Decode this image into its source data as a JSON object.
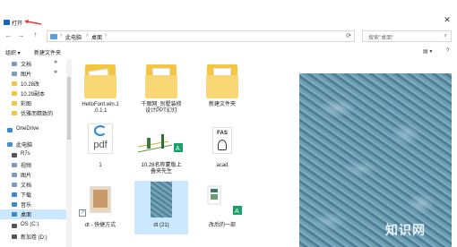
{
  "window": {
    "title": "打开",
    "close_glyph": "✕"
  },
  "nav": {
    "back": "←",
    "forward": "→",
    "up": "↑",
    "breadcrumbs": [
      "此电脑",
      "桌面"
    ],
    "refresh_glyph": "⟳",
    "search_placeholder": "搜索\"桌面\"",
    "search_glyph": "⌕"
  },
  "toolbar": {
    "organize": "组织 ▾",
    "new_folder": "新建文件夹",
    "view_glyph": "▤ ▾",
    "help_glyph": "?"
  },
  "sidebar": {
    "items": [
      {
        "label": "文档",
        "icon": "document-icon",
        "color": "#7a9cc6",
        "pin": "✱"
      },
      {
        "label": "图片",
        "icon": "picture-icon",
        "color": "#7a9cc6",
        "pin": "✱"
      },
      {
        "label": "10.28改",
        "icon": "folder-icon",
        "color": "#f5c542"
      },
      {
        "label": "10.29副本",
        "icon": "folder-icon",
        "color": "#f5c542"
      },
      {
        "label": "彩图",
        "icon": "folder-icon",
        "color": "#f5c542"
      },
      {
        "label": "优雅而精致的",
        "icon": "folder-icon",
        "color": "#f5c542"
      },
      {
        "label": "OneDrive",
        "icon": "cloud-icon",
        "color": "#3a88d8"
      },
      {
        "label": "此电脑",
        "icon": "pc-icon",
        "color": "#4a8fd1"
      },
      {
        "label": "R7s",
        "icon": "device-icon",
        "color": "#555555"
      },
      {
        "label": "视频",
        "icon": "video-icon",
        "color": "#7a9cc6"
      },
      {
        "label": "图片",
        "icon": "picture-icon",
        "color": "#7a9cc6"
      },
      {
        "label": "文档",
        "icon": "document-icon",
        "color": "#7a9cc6"
      },
      {
        "label": "下载",
        "icon": "download-icon",
        "color": "#3a88d8"
      },
      {
        "label": "音乐",
        "icon": "music-icon",
        "color": "#3a88d8"
      },
      {
        "label": "桌面",
        "icon": "desktop-icon",
        "color": "#3a88d8"
      },
      {
        "label": "OS (C:)",
        "icon": "drive-icon",
        "color": "#555555"
      },
      {
        "label": "新加卷 (D:)",
        "icon": "drive-icon",
        "color": "#555555"
      }
    ],
    "selected_index": 14
  },
  "files": [
    {
      "name": "HelloFont.win.1\n.0.1.1",
      "kind": "folder"
    },
    {
      "name": "千图网_别墅装修\n设计PPT幻灯",
      "kind": "folder"
    },
    {
      "name": "新建文件夹",
      "kind": "folder"
    },
    {
      "name": "1",
      "kind": "pdf",
      "badge": "pdf"
    },
    {
      "name": "10.28名称蒙版上\n叠来先生",
      "kind": "image"
    },
    {
      "name": "acad",
      "kind": "fas",
      "badge": "FAS"
    },
    {
      "name": "dt - 快捷方式",
      "kind": "shortcut"
    },
    {
      "name": "dt (21)",
      "kind": "image-selected"
    },
    {
      "name": "改后的一部",
      "kind": "image"
    }
  ],
  "watermark": "知识网"
}
